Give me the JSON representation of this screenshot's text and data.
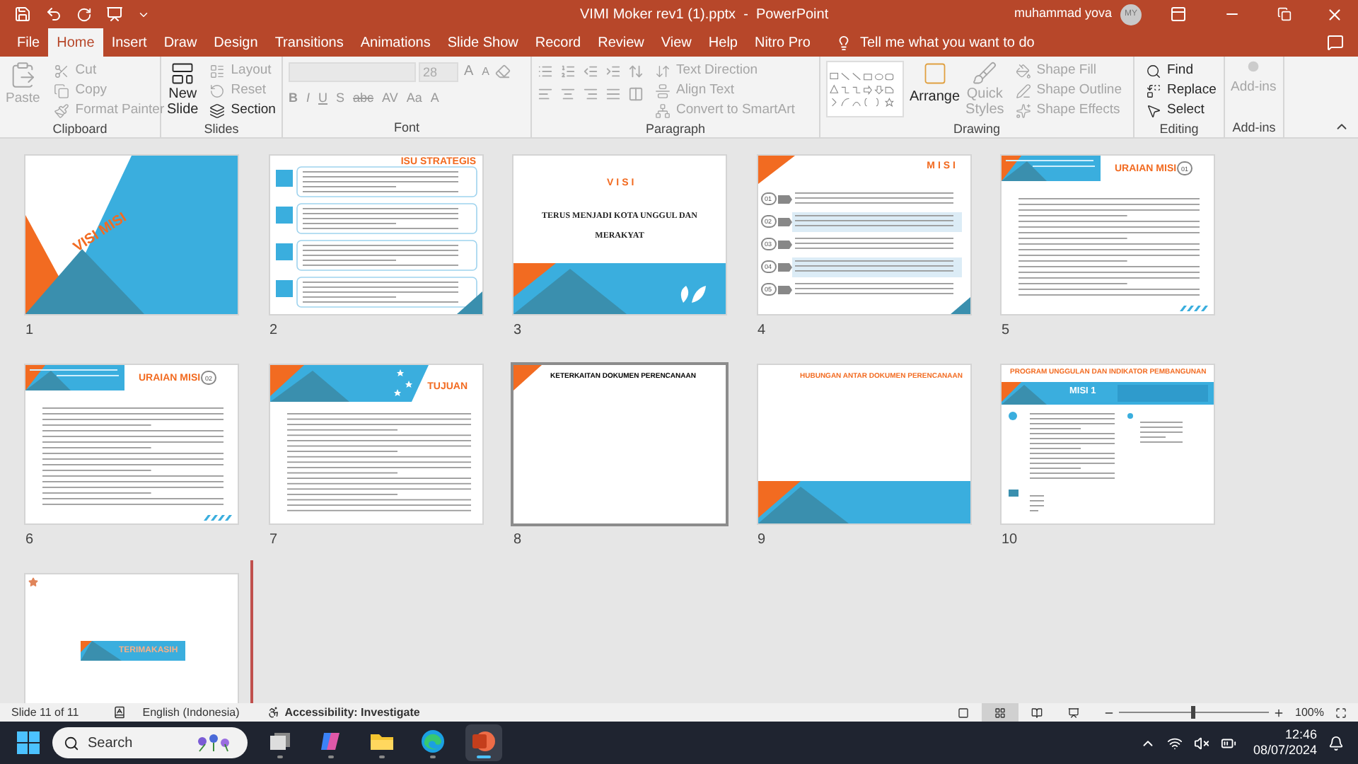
{
  "title_bar": {
    "title": "VIMI Moker rev1 (1).pptx  -  PowerPoint",
    "user": "muhammad yova",
    "avatar": "MY"
  },
  "menu_tabs": [
    {
      "label": "File",
      "selected": false
    },
    {
      "label": "Home",
      "selected": true
    },
    {
      "label": "Insert",
      "selected": false
    },
    {
      "label": "Draw",
      "selected": false
    },
    {
      "label": "Design",
      "selected": false
    },
    {
      "label": "Transitions",
      "selected": false
    },
    {
      "label": "Animations",
      "selected": false
    },
    {
      "label": "Slide Show",
      "selected": false
    },
    {
      "label": "Record",
      "selected": false
    },
    {
      "label": "Review",
      "selected": false
    },
    {
      "label": "View",
      "selected": false
    },
    {
      "label": "Help",
      "selected": false
    },
    {
      "label": "Nitro Pro",
      "selected": false
    }
  ],
  "tell_me": "Tell me what you want to do",
  "ribbon": {
    "clipboard": {
      "label": "Clipboard",
      "paste": {
        "label": "Paste",
        "disabled": true
      },
      "items": [
        {
          "label": "Cut",
          "disabled": true
        },
        {
          "label": "Copy",
          "disabled": true
        },
        {
          "label": "Format Painter",
          "disabled": true
        }
      ]
    },
    "slides": {
      "label": "Slides",
      "new_slide": [
        "New",
        "Slide"
      ],
      "items": [
        {
          "label": "Layout",
          "disabled": true
        },
        {
          "label": "Reset",
          "disabled": true
        },
        {
          "label": "Section",
          "disabled": false
        }
      ]
    },
    "font": {
      "label": "Font",
      "font_size": "28",
      "size_buttons": [
        "A",
        "A"
      ],
      "format_buttons": [
        "B",
        "I",
        "U",
        "S",
        "abc",
        "AV",
        "Aa",
        "A"
      ]
    },
    "paragraph": {
      "label": "Paragraph",
      "items": [
        {
          "label": "Text Direction",
          "disabled": true
        },
        {
          "label": "Align Text",
          "disabled": true
        },
        {
          "label": "Convert to SmartArt",
          "disabled": true
        }
      ]
    },
    "drawing": {
      "label": "Drawing",
      "arrange": "Arrange",
      "quick_styles": [
        "Quick",
        "Styles"
      ],
      "items": [
        {
          "label": "Shape Fill",
          "disabled": true
        },
        {
          "label": "Shape Outline",
          "disabled": true
        },
        {
          "label": "Shape Effects",
          "disabled": true
        }
      ]
    },
    "editing": {
      "label": "Editing",
      "items": [
        {
          "label": "Find",
          "disabled": false
        },
        {
          "label": "Replace",
          "disabled": false
        },
        {
          "label": "Select",
          "disabled": false
        }
      ]
    },
    "addins": {
      "label": "Add-ins",
      "button": {
        "label": "Add-ins",
        "disabled": true
      }
    }
  },
  "slides": [
    {
      "number": "1",
      "kind": "cover",
      "title": "VISI MISI",
      "hovered": false,
      "animated": false
    },
    {
      "number": "2",
      "kind": "list",
      "title": "ISU STRATEGIS",
      "hovered": false,
      "animated": false
    },
    {
      "number": "3",
      "kind": "visi",
      "title": "VISI",
      "subtitle": "TERUS MENJADI KOTA UNGGUL DAN MERAKYAT",
      "hovered": false,
      "animated": false
    },
    {
      "number": "4",
      "kind": "misi",
      "title": "MISI",
      "markers": [
        "01",
        "02",
        "03",
        "04",
        "05"
      ],
      "hovered": false,
      "animated": false
    },
    {
      "number": "5",
      "kind": "text",
      "title": "URAIAN MISI",
      "badge": "01",
      "hovered": false,
      "animated": false
    },
    {
      "number": "6",
      "kind": "text",
      "title": "URAIAN MISI",
      "badge": "02",
      "hovered": false,
      "animated": false
    },
    {
      "number": "7",
      "kind": "tujuan",
      "title": "TUJUAN",
      "hovered": false,
      "animated": false
    },
    {
      "number": "8",
      "kind": "plain",
      "title": "KETERKAITAN DOKUMEN PERENCANAAN",
      "hovered": true,
      "animated": false
    },
    {
      "number": "9",
      "kind": "band",
      "title": "HUBUNGAN ANTAR DOKUMEN PERENCANAAN",
      "hovered": false,
      "animated": false
    },
    {
      "number": "10",
      "kind": "program",
      "title": "PROGRAM UNGGULAN DAN INDIKATOR PEMBANGUNAN",
      "badge": "MISI 1",
      "hovered": false,
      "animated": false
    },
    {
      "kind": "end",
      "title": "TERIMAKASIH",
      "hovered": false,
      "animated": true
    }
  ],
  "status_bar": {
    "slide": "Slide 11 of 11",
    "language": "English (Indonesia)",
    "accessibility": "Accessibility: Investigate",
    "views": [
      {
        "selected": false
      },
      {
        "selected": true
      },
      {
        "selected": false
      },
      {
        "selected": false
      }
    ],
    "zoom": {
      "level": 0.5,
      "reading": "100%"
    }
  },
  "taskbar": {
    "search": {
      "placeholder": "Search"
    },
    "apps": [
      {
        "kind": "taskview",
        "active": false
      },
      {
        "kind": "copilot",
        "active": false
      },
      {
        "kind": "explorer",
        "active": false
      },
      {
        "kind": "edge",
        "active": false
      },
      {
        "kind": "powerpoint",
        "active": true
      }
    ],
    "time": "12:46",
    "date": "08/07/2024"
  }
}
